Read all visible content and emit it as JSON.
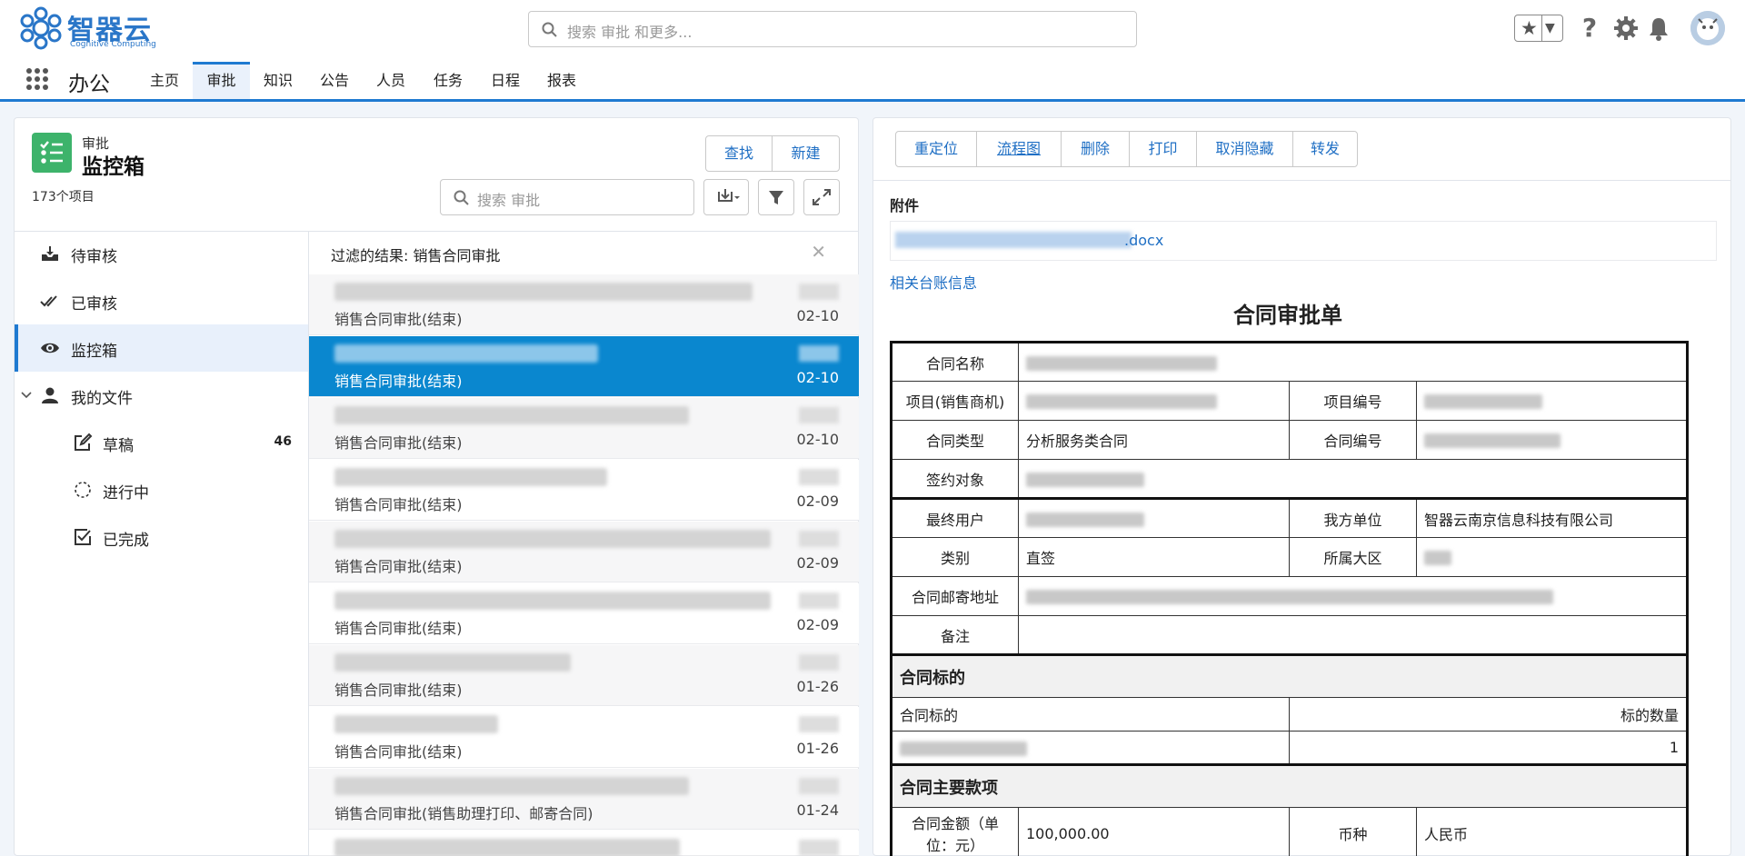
{
  "brand": {
    "name": "智器云",
    "tagline": "Cognitive Computing"
  },
  "header": {
    "search_placeholder": "搜索 审批 和更多..."
  },
  "nav": {
    "app_name": "办公",
    "tabs": [
      {
        "label": "主页"
      },
      {
        "label": "审批"
      },
      {
        "label": "知识"
      },
      {
        "label": "公告"
      },
      {
        "label": "人员"
      },
      {
        "label": "任务"
      },
      {
        "label": "日程"
      },
      {
        "label": "报表"
      }
    ]
  },
  "left_panel": {
    "caption": "审批",
    "title": "监控箱",
    "count": "173个项目",
    "find_label": "查找",
    "new_label": "新建",
    "search_placeholder": "搜索 审批"
  },
  "sidebar": {
    "items": [
      {
        "label": "待审核",
        "icon": "inbox-download-icon"
      },
      {
        "label": "已审核",
        "icon": "double-check-icon"
      },
      {
        "label": "监控箱",
        "icon": "eye-icon"
      },
      {
        "label": "我的文件",
        "icon": "person-icon"
      },
      {
        "label": "草稿",
        "icon": "edit-icon",
        "badge": "46"
      },
      {
        "label": "进行中",
        "icon": "spinner-icon"
      },
      {
        "label": "已完成",
        "icon": "checkbox-icon"
      }
    ]
  },
  "list": {
    "filter_text": "过滤的结果: 销售合同审批",
    "rows": [
      {
        "subtitle": "销售合同审批(结束)",
        "date": "02-10"
      },
      {
        "subtitle": "销售合同审批(结束)",
        "date": "02-10"
      },
      {
        "subtitle": "销售合同审批(结束)",
        "date": "02-10"
      },
      {
        "subtitle": "销售合同审批(结束)",
        "date": "02-09"
      },
      {
        "subtitle": "销售合同审批(结束)",
        "date": "02-09"
      },
      {
        "subtitle": "销售合同审批(结束)",
        "date": "02-09"
      },
      {
        "subtitle": "销售合同审批(结束)",
        "date": "01-26"
      },
      {
        "subtitle": "销售合同审批(结束)",
        "date": "01-26"
      },
      {
        "subtitle": "销售合同审批(销售助理打印、邮寄合同)",
        "date": "01-24"
      },
      {
        "subtitle": "",
        "date": ""
      }
    ]
  },
  "detail": {
    "toolbar": [
      "重定位",
      "流程图",
      "删除",
      "打印",
      "取消隐藏",
      "转发"
    ],
    "attachments_heading": "附件",
    "attachment_ext": ".docx",
    "ledger_link": "相关台账信息",
    "form_title": "合同审批单",
    "labels": {
      "contract_name": "合同名称",
      "project": "项目(销售商机)",
      "project_no": "项目编号",
      "contract_type": "合同类型",
      "contract_type_value": "分析服务类合同",
      "contract_no": "合同编号",
      "party": "签约对象",
      "end_user": "最终用户",
      "our_unit": "我方单位",
      "our_unit_value": "智器云南京信息科技有限公司",
      "category": "类别",
      "category_value": "直签",
      "region": "所属大区",
      "address": "合同邮寄地址",
      "remark": "备注",
      "subject_section": "合同标的",
      "subject_col": "合同标的",
      "qty_col": "标的数量",
      "qty_value": "1",
      "terms_section": "合同主要款项",
      "amount": "合同金额（单位：元）",
      "amount_value": "100,000.00",
      "currency": "币种",
      "currency_value": "人民币"
    }
  }
}
